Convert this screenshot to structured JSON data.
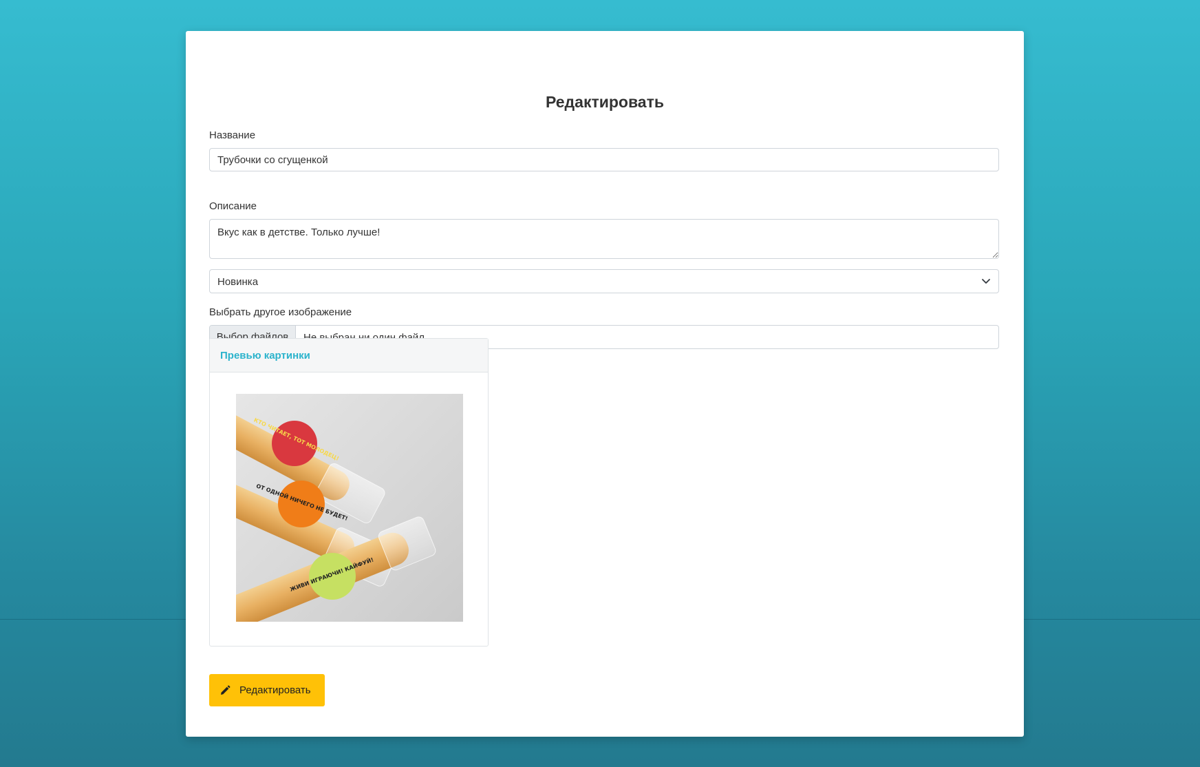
{
  "form": {
    "heading": "Редактировать",
    "name_label": "Название",
    "name_value": "Трубочки со сгущенкой",
    "description_label": "Описание",
    "description_value": "Вкус как в детстве. Только лучше!",
    "status_selected": "Новинка",
    "image_label": "Выбрать другое изображение",
    "file_button_label": "Выбор файлов",
    "file_status": "Не выбран ни один файл",
    "preview_header": "Превью картинки",
    "submit_label": "Редактировать"
  },
  "preview_image": {
    "sticker_texts": [
      "КТО ЧИТАЕТ, ТОТ МОЛОДЕЦ!",
      "ОТ ОДНОЙ НИЧЕГО НЕ БУДЕТ!",
      "ЖИВИ ИГРАЮЧИ! КАЙФУЙ!"
    ]
  },
  "colors": {
    "accent": "#2bb3cc",
    "button": "#ffc107"
  }
}
